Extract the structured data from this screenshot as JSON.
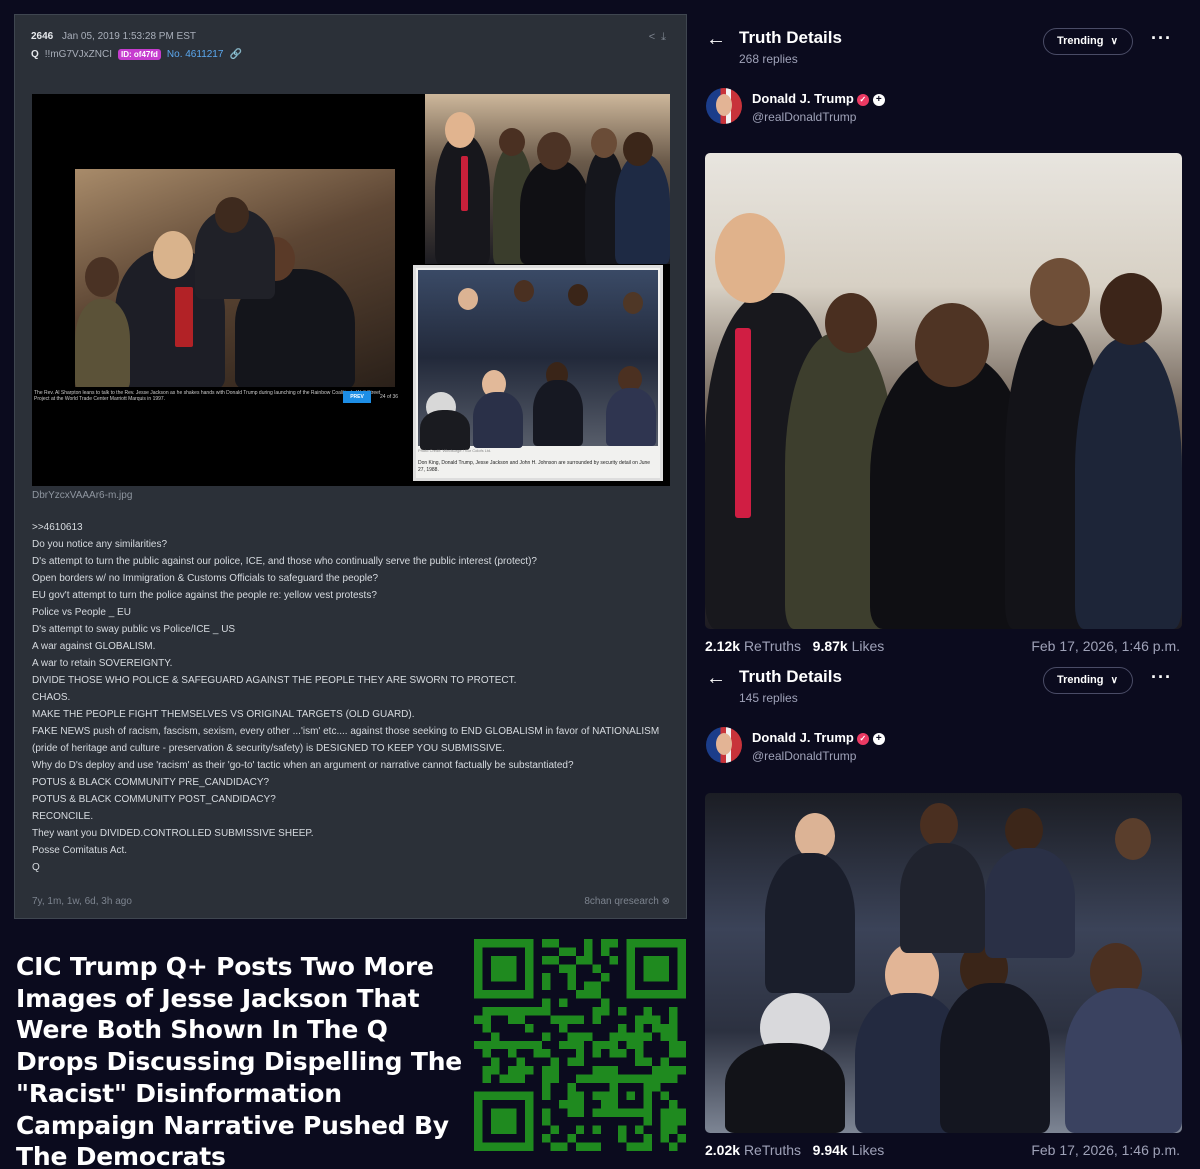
{
  "qdrop": {
    "post_number": "2646",
    "date": "Jan 05, 2019 1:53:28 PM EST",
    "author": "Q",
    "tripcode": "!!mG7VJxZNCI",
    "id_badge": "ID: of47fd",
    "post_id": "No. 4611217",
    "image": {
      "caption_left": "The Rev. Al Sharpton leans to talk to the Rev. Jesse Jackson as he shakes hands with Donald Trump during launching of the Rainbow Coalition's Wall Street Project at the World Trade Center Marriott Marquis in 1997.",
      "prev_button": "PREV",
      "page_indicator": "24 of 36",
      "photo_credit": "Photo Credit: Windsurge / Sur Colofs Ltd.",
      "caption_right": "Don King, Donald Trump, Jesse Jackson and John H. Johnson are surrounded by security detail on June 27, 1988."
    },
    "filename": "DbrYzcxVAAAr6-m.jpg",
    "lines": [
      ">>4610613",
      "Do you notice any similarities?",
      "D's attempt to turn the public against our police, ICE, and those who continually serve the public interest (protect)?",
      "Open borders w/ no Immigration & Customs Officials to safeguard the people?",
      "EU gov't attempt to turn the police against the people re: yellow vest protests?",
      "Police vs People _ EU",
      "D's attempt to sway public vs Police/ICE _ US",
      "A war against GLOBALISM.",
      "A war to retain SOVEREIGNTY.",
      "DIVIDE THOSE WHO POLICE & SAFEGUARD AGAINST THE PEOPLE THEY ARE SWORN TO PROTECT.",
      "CHAOS.",
      "MAKE THE PEOPLE FIGHT THEMSELVES VS ORIGINAL TARGETS (OLD GUARD).",
      "FAKE NEWS push of racism, fascism, sexism, every other ...'ism' etc.... against those seeking to END GLOBALISM in favor of NATIONALISM",
      "(pride of heritage and culture - preservation & security/safety) is DESIGNED TO KEEP YOU SUBMISSIVE.",
      "Why do D's deploy and use 'racism' as their 'go-to' tactic when an argument or narrative cannot factually be substantiated?",
      "POTUS & BLACK COMMUNITY PRE_CANDIDACY?",
      "POTUS & BLACK COMMUNITY POST_CANDIDACY?",
      "RECONCILE.",
      "They want you DIVIDED.CONTROLLED SUBMISSIVE SHEEP.",
      "Posse Comitatus Act.",
      "Q"
    ],
    "age": "7y, 1m, 1w, 6d, 3h ago",
    "source": "8chan qresearch"
  },
  "headline": "CIC Trump Q+ Posts Two More Images of Jesse Jackson That Were Both Shown In The Q Drops Discussing Dispelling The \"Racist\" Disinformation Campaign Narrative Pushed By The Democrats",
  "colors": {
    "background": "#0b0b1e",
    "qpanel": "#2b3038",
    "qr_green": "#1f8a1f",
    "id_badge": "#c63ccf",
    "verified": "#ec3a63",
    "link": "#5ba8ef"
  },
  "truths": [
    {
      "title": "Truth Details",
      "replies": "268 replies",
      "sort": "Trending",
      "author_name": "Donald J. Trump",
      "author_handle": "@realDonaldTrump",
      "retruths_count": "2.12k",
      "retruths_label": "ReTruths",
      "likes_count": "9.87k",
      "likes_label": "Likes",
      "date": "Feb 17, 2026, 1:46 p.m."
    },
    {
      "title": "Truth Details",
      "replies": "145 replies",
      "sort": "Trending",
      "author_name": "Donald J. Trump",
      "author_handle": "@realDonaldTrump",
      "retruths_count": "2.02k",
      "retruths_label": "ReTruths",
      "likes_count": "9.94k",
      "likes_label": "Likes",
      "date": "Feb 17, 2026, 1:46 p.m."
    }
  ],
  "icons": {
    "share": "share-icon",
    "download": "download-icon",
    "link": "link-icon",
    "back": "arrow-left-icon",
    "more": "more-dots-icon",
    "close": "close-circle-icon"
  }
}
